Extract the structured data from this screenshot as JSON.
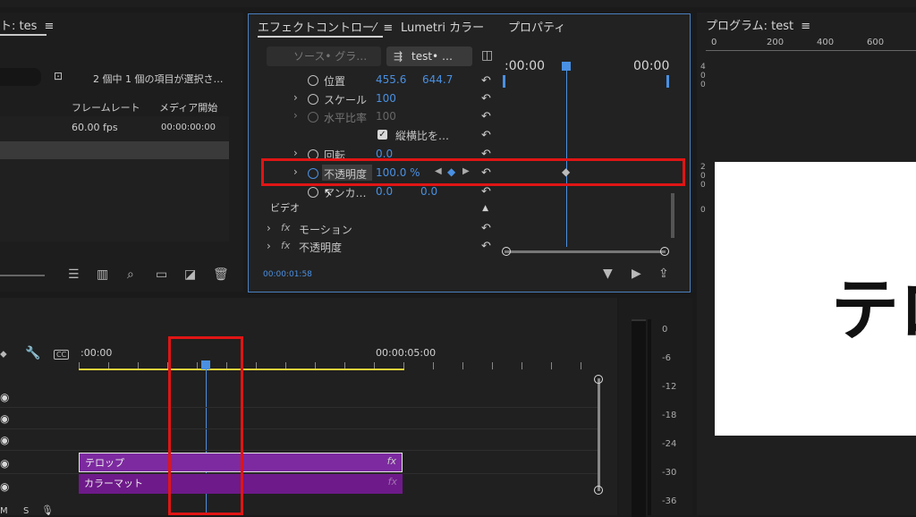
{
  "project_panel": {
    "tab_title": "ト: tes",
    "selection_info": "2 個中 1 個の項目が選択さ…",
    "columns": [
      "フレームレート",
      "メディア開始"
    ],
    "row": {
      "fps": "60.00 fps",
      "start": "00:00:00:00"
    }
  },
  "effects_panel": {
    "tabs": [
      "エフェクトコントロー⁄",
      "Lumetri カラー",
      "プロパティ"
    ],
    "source_label": "ソース• グラ…",
    "clip_label": "test• …",
    "time_start": ":00:00",
    "time_end": "00:00",
    "rows": [
      {
        "name": "位置",
        "v1": "455.6",
        "v2": "644.7"
      },
      {
        "name": "スケール",
        "v1": "100"
      },
      {
        "name": "水平比率",
        "v1": "100"
      },
      {
        "name": "縦横比を…"
      },
      {
        "name": "回転",
        "v1": "0.0"
      },
      {
        "name": "不透明度",
        "v1": "100.0 %"
      },
      {
        "name": "アンカ…",
        "v1": "0.0",
        "v2": "0.0"
      }
    ],
    "section": "ビデオ",
    "fx_rows": [
      "モーション",
      "不透明度"
    ],
    "fx_label": "fx",
    "timecode": "00:00:01:58"
  },
  "program_panel": {
    "tab_title": "プログラム: test",
    "ruler_labels": [
      "0",
      "200",
      "400",
      "600"
    ],
    "v_ruler": [
      "4",
      "0",
      "0",
      "2",
      "0",
      "0",
      "0"
    ],
    "preview_text": "テロ"
  },
  "timeline": {
    "time_start": ":00:00",
    "time_mid": "00:00:05:00",
    "clips": [
      {
        "label": "テロップ",
        "fx": "fx"
      },
      {
        "label": "カラーマット",
        "fx": "fx"
      }
    ],
    "bottom_labels": [
      "M",
      "S"
    ]
  },
  "audio_meter": {
    "labels": [
      "0",
      "-6",
      "-12",
      "-18",
      "-24",
      "-30",
      "-36"
    ]
  },
  "colors": {
    "accent": "#4a90e2",
    "highlight": "#e01515",
    "clip": "#7a1f9c"
  }
}
